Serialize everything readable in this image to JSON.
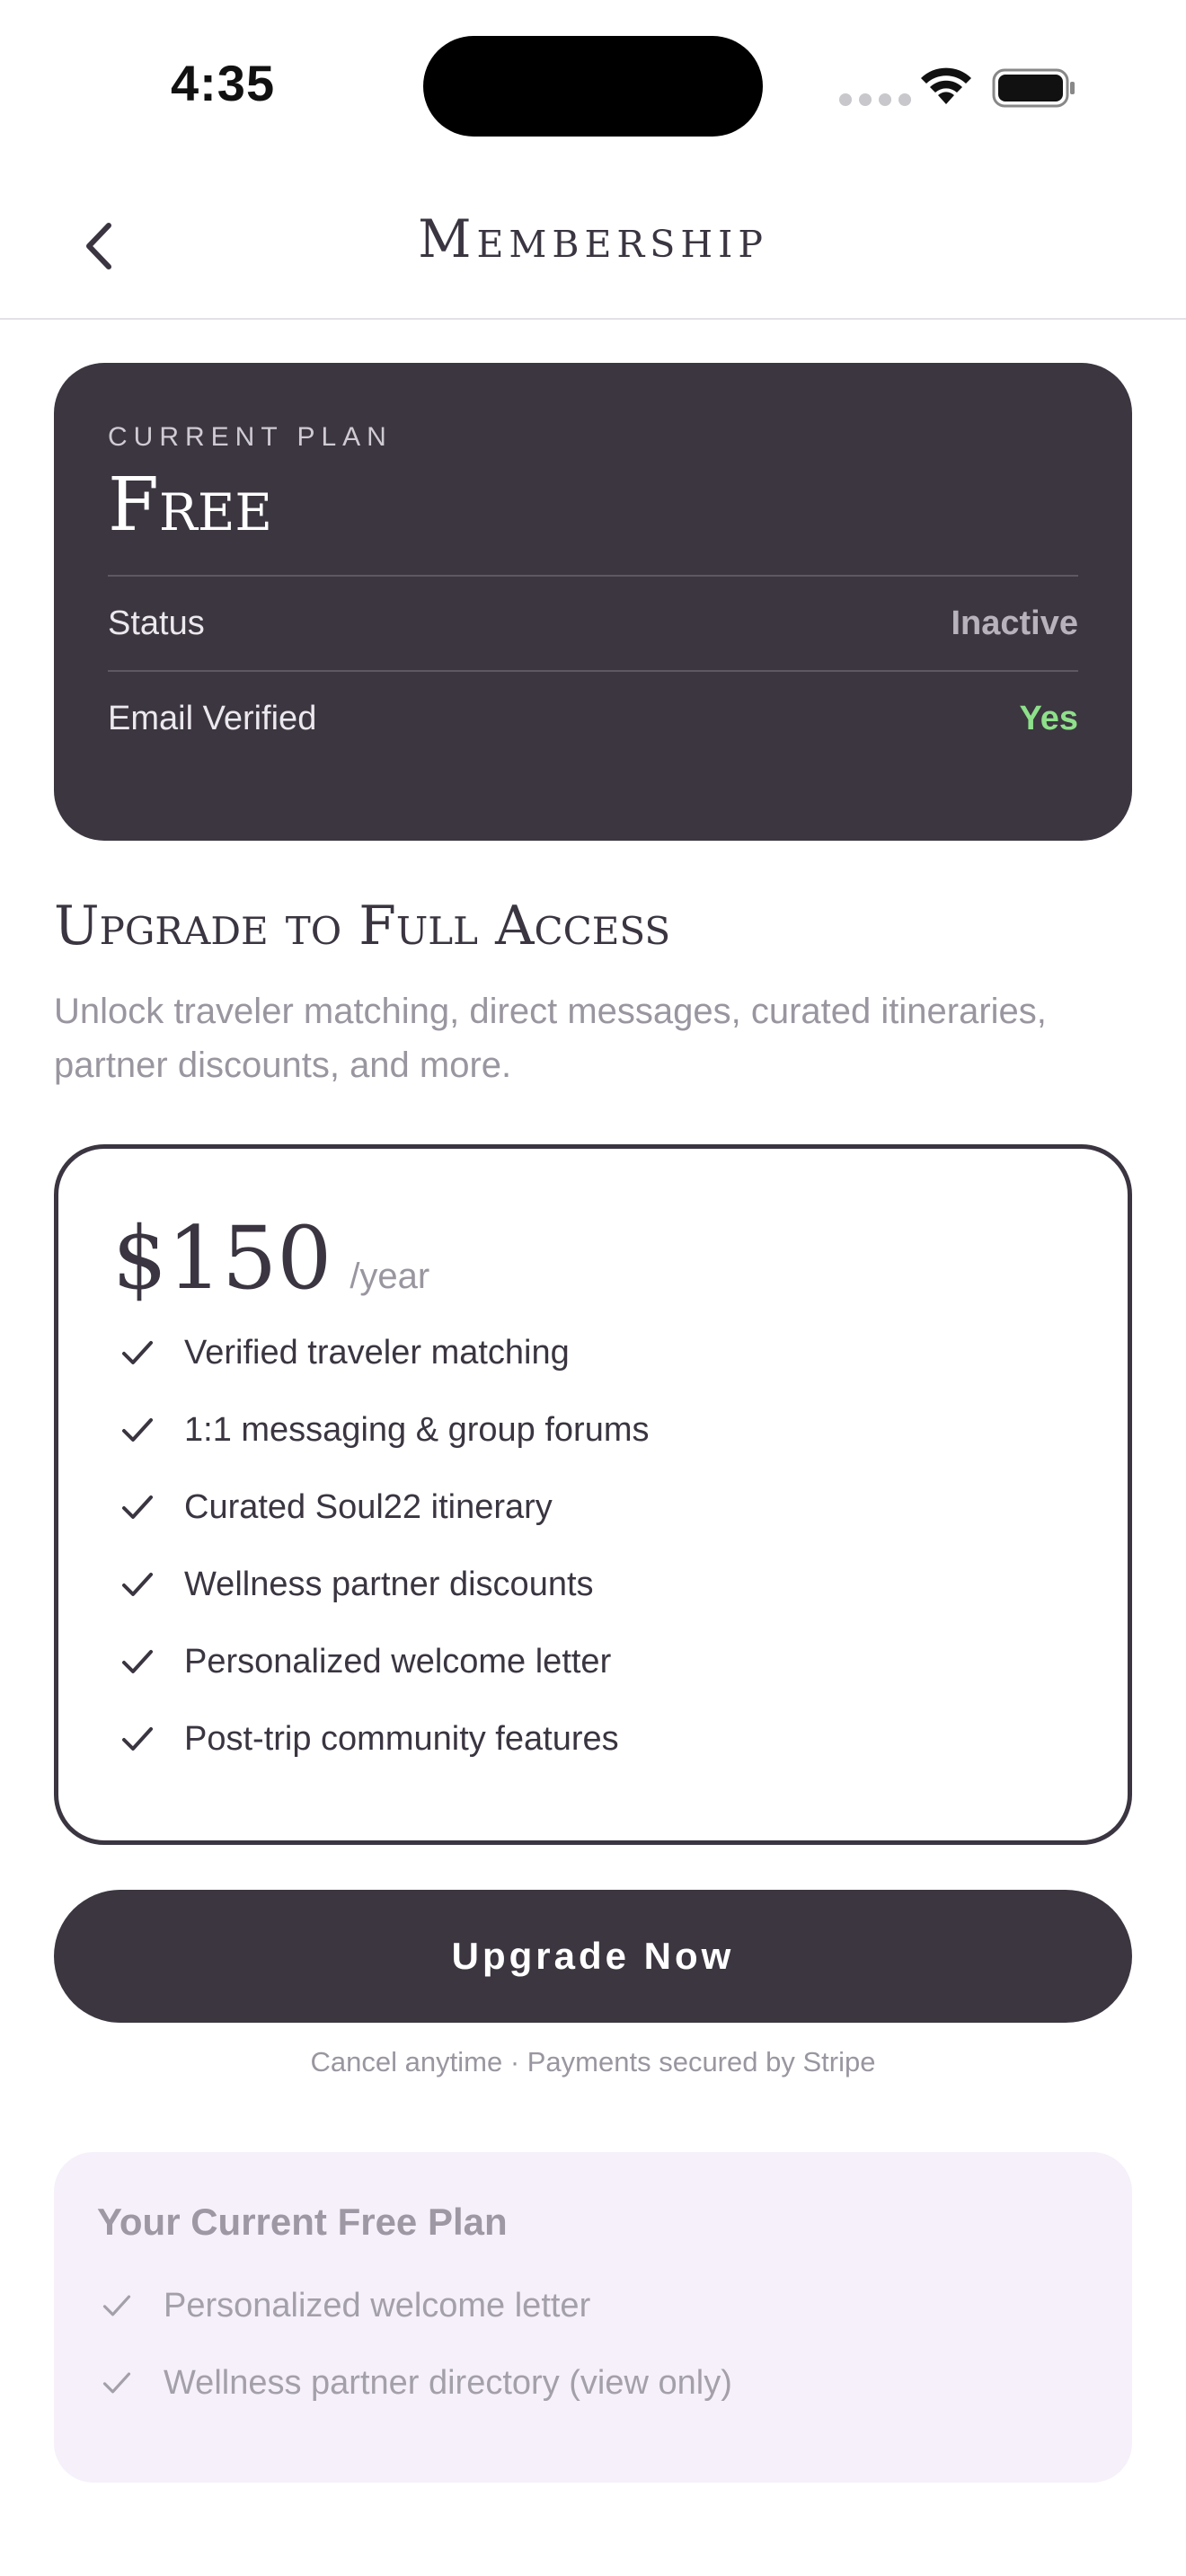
{
  "status_bar": {
    "time": "4:35"
  },
  "nav": {
    "title": "Membership",
    "back_icon": "chevron-left-icon"
  },
  "current_plan": {
    "eyebrow": "CURRENT PLAN",
    "name": "Free",
    "rows": [
      {
        "label": "Status",
        "value": "Inactive",
        "color": "#b7b2bc"
      },
      {
        "label": "Email Verified",
        "value": "Yes",
        "color": "#8ee08a"
      }
    ]
  },
  "upgrade": {
    "heading": "Upgrade to Full Access",
    "subtitle": "Unlock traveler matching, direct messages, curated itineraries, partner discounts, and more."
  },
  "pricing": {
    "amount": "$150",
    "period": "/year",
    "features": [
      "Verified traveler matching",
      "1:1 messaging & group forums",
      "Curated Soul22 itinerary",
      "Wellness partner discounts",
      "Personalized welcome letter",
      "Post-trip community features"
    ]
  },
  "cta": {
    "label": "Upgrade Now",
    "note": "Cancel anytime · Payments secured by Stripe"
  },
  "free_plan": {
    "title": "Your Current Free Plan",
    "features": [
      "Personalized welcome letter",
      "Wellness partner directory (view only)"
    ]
  },
  "colors": {
    "accent": "#3c3640",
    "verified": "#8ee08a",
    "free_bg": "#f5f0fa"
  }
}
